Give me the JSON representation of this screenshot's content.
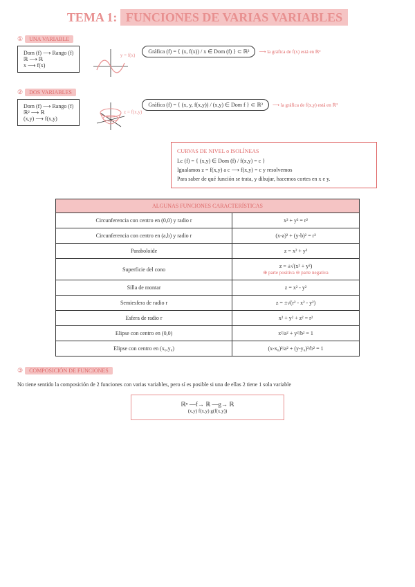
{
  "title_prefix": "TEMA 1:",
  "title_main": "FUNCIONES DE VARIAS VARIABLES",
  "sec1": {
    "num": "①",
    "label": "UNA VARIABLE",
    "map1": "Dom (f) ⟶ Rango (f)",
    "map2": "ℝ ⟶ ℝ",
    "map3": "x ⟶ f(x)",
    "graph_label": "y = f(x)",
    "formula": "Gráfica (f) = { (x, f(x)) / x ∈ Dom (f) } ⊂ ℝ²",
    "note": "⟶ la gráfica de f(x) está en ℝ²"
  },
  "sec2": {
    "num": "②",
    "label": "DOS VARIABLES",
    "map1": "Dom (f) ⟶ Rango (f)",
    "map2": "ℝ² ⟶ ℝ",
    "map3": "(x,y) ⟶ f(x,y)",
    "graph_label": "z = f(x,y)",
    "formula": "Gráfica (f) = { (x, y, f(x,y)) / (x,y) ∈ Dom f } ⊂ ℝ³",
    "note": "⟶ la gráfica de f(x,y) está en ℝ³"
  },
  "curvas": {
    "hdr": "CURVAS DE NIVEL o ISOLÍNEAS",
    "l1": "Lc (f) = { (x,y) ∈ Dom (f) / f(x,y) = c }",
    "l2": "Igualamos  z = f(x,y) a c ⟶ f(x,y) = c  y resolvemos",
    "l3": "Para saber de qué función se trata, y dibujar, hacemos cortes en x e y."
  },
  "table": {
    "header": "ALGUNAS FUNCIONES CARACTERÍSTICAS",
    "rows": [
      {
        "name": "Circunferencia con centro en (0,0) y radio r",
        "eq": "x² + y² = r²"
      },
      {
        "name": "Circunferencia con centro en (a,b) y radio r",
        "eq": "(x-a)² + (y-b)² = r²"
      },
      {
        "name": "Paraboloide",
        "eq": "z = x² + y²"
      },
      {
        "name": "Superficie del cono",
        "eq": "z = ±√(x² + y²)",
        "note": "⊕ parte positiva ⊖ parte negativa"
      },
      {
        "name": "Silla de montar",
        "eq": "z = x² - y²"
      },
      {
        "name": "Semiesfera de radio r",
        "eq": "z = ±√(r² - x² - y²)"
      },
      {
        "name": "Esfera de radio r",
        "eq": "x² + y² + z² = r²"
      },
      {
        "name": "Elipse con centro en (0,0)",
        "eq": "x²/a² + y²/b² = 1"
      },
      {
        "name": "Elipse con centro en (x₀,y₀)",
        "eq": "(x-x₀)²/a² + (y-y₀)²/b² = 1"
      }
    ]
  },
  "sec3": {
    "num": "③",
    "label": "COMPOSICIÓN DE FUNCIONES",
    "text": "No tiene sentido la composición de 2 funciones con varias variables, pero sí es posible si una de ellas 2 tiene 1 sola variable",
    "comp_l1": "ℝⁿ  —f→  ℝ  —g→  ℝ",
    "comp_l2": "(x,y)      f(x,y)       g(f(x,y))"
  }
}
